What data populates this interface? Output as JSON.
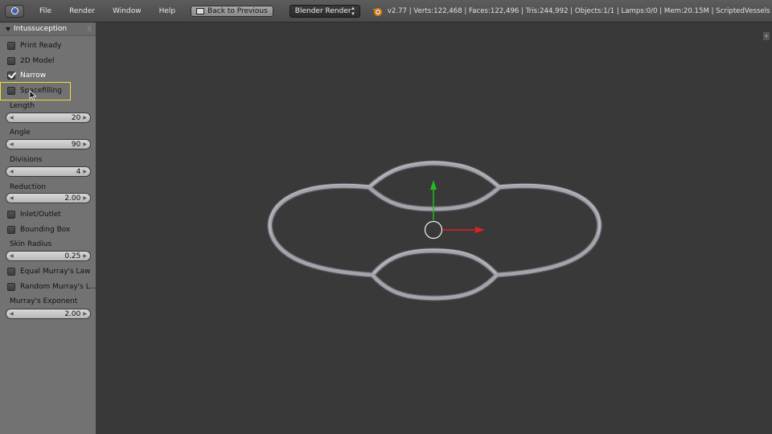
{
  "header": {
    "menus": [
      "File",
      "Render",
      "Window",
      "Help"
    ],
    "back_button": "Back to Previous",
    "render_engine": "Blender Render",
    "stats": "v2.77 | Verts:122,468 | Faces:122,496 | Tris:244,992 | Objects:1/1 | Lamps:0/0 | Mem:20.15M | ScriptedVessels"
  },
  "panel": {
    "title": "Intussuception",
    "print_ready": {
      "label": "Print Ready",
      "checked": false
    },
    "model_2d": {
      "label": "2D Model",
      "checked": false
    },
    "narrow": {
      "label": "Narrow",
      "checked": true
    },
    "spacefilling": {
      "label": "Spacefilling",
      "checked": false
    },
    "length": {
      "label": "Length",
      "value": "20"
    },
    "angle": {
      "label": "Angle",
      "value": "90"
    },
    "divisions": {
      "label": "Divisions",
      "value": "4"
    },
    "reduction": {
      "label": "Reduction",
      "value": "2.00"
    },
    "inlet_outlet": {
      "label": "Inlet/Outlet",
      "checked": false
    },
    "bounding_box": {
      "label": "Bounding Box",
      "checked": false
    },
    "skin_radius": {
      "label": "Skin Radius",
      "value": "0.25"
    },
    "equal_murray": {
      "label": "Equal Murray's Law",
      "checked": false
    },
    "random_murray": {
      "label": "Random Murray's L...",
      "checked": false
    },
    "murray_exponent": {
      "label": "Murray's Exponent",
      "value": "2.00"
    }
  },
  "colors": {
    "viewport_bg": "#393939",
    "panel_bg": "#727272",
    "highlight": "#f0e030",
    "gizmo_y": "#22bb22",
    "gizmo_x": "#dd2222",
    "vessel": "#9a9aa2"
  }
}
